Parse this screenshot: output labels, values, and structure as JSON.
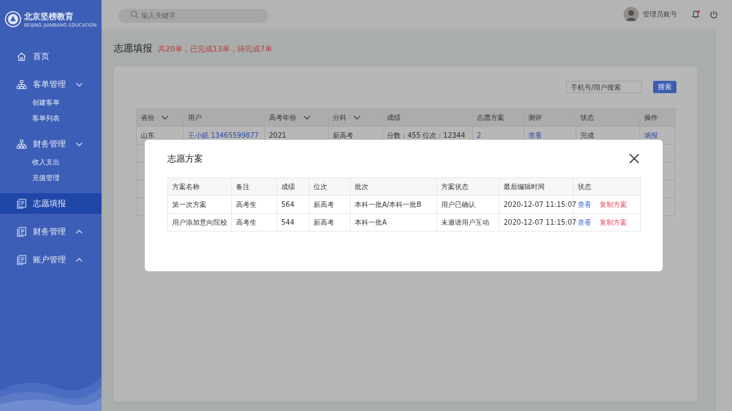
{
  "sidebar": {
    "logo": {
      "name": "北京坚榜教育",
      "subtitle": "BEIJING JIANBANG EDUCATION"
    },
    "items": [
      {
        "label": "首页",
        "selected": false
      },
      {
        "label": "客单管理",
        "selected": false,
        "expanded": true,
        "children": [
          {
            "label": "创建客单",
            "selected": false
          },
          {
            "label": "客单列表",
            "selected": false
          }
        ]
      },
      {
        "label": "财务管理",
        "selected": false,
        "expanded": true,
        "children": [
          {
            "label": "收入支出",
            "selected": false
          },
          {
            "label": "充值管理",
            "selected": false
          }
        ]
      },
      {
        "label": "志愿填报",
        "selected": true
      },
      {
        "label": "财务管理",
        "selected": false,
        "expanded": false
      },
      {
        "label": "账户管理",
        "selected": false,
        "expanded": false
      }
    ]
  },
  "header": {
    "search": {
      "placeholder": "输入关键字"
    },
    "user": "管理员账号",
    "notification_dot": true
  },
  "page": {
    "title": "志愿填报",
    "summary": "共20单，已完成13单，待完成7单"
  },
  "filter": {
    "placeholder": "手机号/用户搜索",
    "button": "搜索"
  },
  "table": {
    "columns": [
      {
        "label": "省份",
        "filter": true
      },
      {
        "label": "用户",
        "filter": false
      },
      {
        "label": "高考年份",
        "filter": true
      },
      {
        "label": "分科",
        "filter": true
      },
      {
        "label": "成绩",
        "filter": false
      },
      {
        "label": "志愿方案",
        "filter": false
      },
      {
        "label": "测评",
        "filter": false
      },
      {
        "label": "状态",
        "filter": false
      },
      {
        "label": "操作",
        "filter": false
      }
    ],
    "rows": [
      {
        "cells": [
          {
            "text": "山东",
            "kind": "text"
          },
          {
            "text": "王小妮  13465599877",
            "kind": "link"
          },
          {
            "text": "2021",
            "kind": "text"
          },
          {
            "text": "新高考",
            "kind": "text"
          },
          {
            "text": "分数：455    位次：12344",
            "kind": "text"
          },
          {
            "text": "2",
            "kind": "link"
          },
          {
            "text": "查看",
            "kind": "link"
          },
          {
            "text": "完成",
            "kind": "text"
          },
          {
            "text": "填报",
            "kind": "link"
          }
        ]
      }
    ]
  },
  "dialog": {
    "title": "志愿方案",
    "columns": [
      "方案名称",
      "备注",
      "成绩",
      "位次",
      "批次",
      "方案状态",
      "最后编辑时间",
      "状态"
    ],
    "rows": [
      {
        "cells": [
          "第一次方案",
          "高考生",
          "564",
          "新高考",
          "本科一批A/本科一批B",
          "用户已确认",
          "2020-12-07 11:15:07"
        ],
        "actions": [
          {
            "label": "查看",
            "kind": "view"
          },
          {
            "label": "复制方案",
            "kind": "copy"
          }
        ]
      },
      {
        "cells": [
          "用户添加意向院校",
          "高考生",
          "544",
          "新高考",
          "本科一批A",
          "未邀请用户互动",
          "2020-12-07 11:15:07"
        ],
        "actions": [
          {
            "label": "查看",
            "kind": "view"
          },
          {
            "label": "复制方案",
            "kind": "copy"
          }
        ]
      }
    ]
  }
}
